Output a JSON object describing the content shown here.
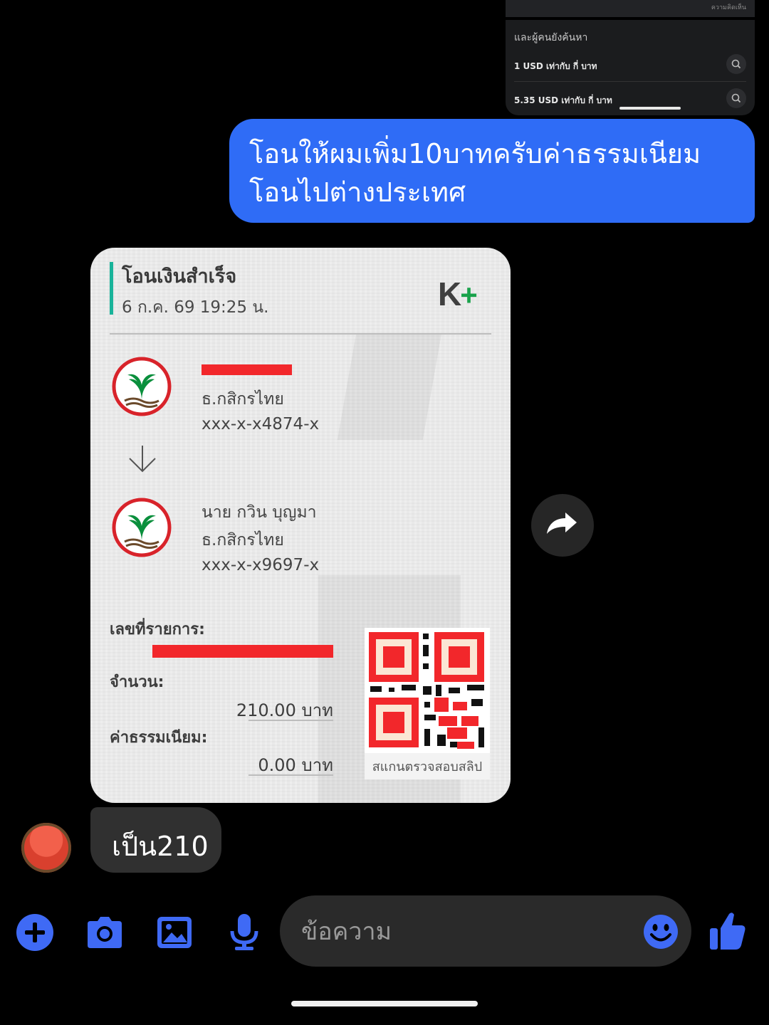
{
  "top_screenshot": {
    "strip_text": "ความคิดเห็น",
    "heading": "และผู้คนยังค้นหา",
    "suggestions": [
      {
        "text": "1 USD เท่ากับ กี่ บาท",
        "icon": "search-icon"
      },
      {
        "text": "5.35 USD เท่ากับ กี่ บาท",
        "icon": "search-icon"
      }
    ]
  },
  "outgoing_message": {
    "text": "โอนให้ผมเพิ่ม10บาทครับค่าธรรมเนียมโอนไปต่างประเทศ",
    "color": "#2f6cf6"
  },
  "slip": {
    "title": "โอนเงินสำเร็จ",
    "datetime": "6 ก.ค. 69  19:25 น.",
    "brand": {
      "main": "K",
      "plus": "+"
    },
    "sender": {
      "bank": "ธ.กสิกรไทย",
      "account": "xxx-x-x4874-x"
    },
    "receiver": {
      "name": "นาย กวิน บุญมา",
      "bank": "ธ.กสิกรไทย",
      "account": "xxx-x-x9697-x"
    },
    "transaction_label": "เลขที่รายการ:",
    "amount_label": "จำนวน:",
    "amount_value": "210.00 บาท",
    "fee_label": "ค่าธรรมเนียม:",
    "fee_value": "0.00 บาท",
    "qr_caption": "สแกนตรวจสอบสลิป",
    "accent_color": "#19b39a",
    "redaction_color": "#f2272b"
  },
  "incoming_message": {
    "text": "เป็น210"
  },
  "composer": {
    "placeholder": "ข้อความ",
    "tools": [
      "plus-icon",
      "camera-icon",
      "image-icon",
      "microphone-icon"
    ],
    "accent": "#3f6af5"
  }
}
